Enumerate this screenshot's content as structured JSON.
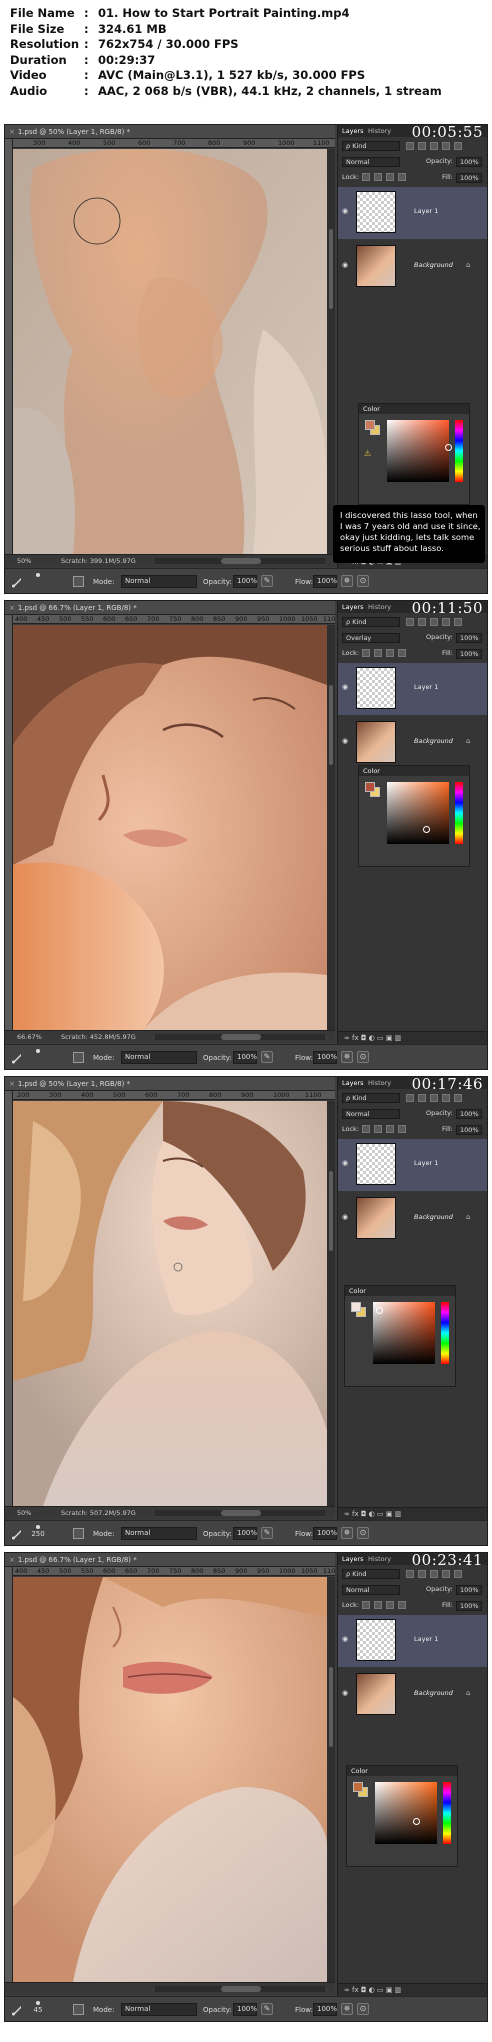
{
  "info": [
    {
      "key": "File Name",
      "value": "01. How to Start Portrait Painting.mp4"
    },
    {
      "key": "File Size",
      "value": "324.61 MB"
    },
    {
      "key": "Resolution",
      "value": "762x754 / 30.000 FPS"
    },
    {
      "key": "Duration",
      "value": "00:29:37"
    },
    {
      "key": "Video",
      "value": "AVC (Main@L3.1), 1 527 kb/s, 30.000 FPS"
    },
    {
      "key": "Audio",
      "value": "AAC, 2 068 b/s (VBR), 44.1 kHz, 2 channels, 1 stream"
    }
  ],
  "info_separator": ":",
  "layers_panel": {
    "tab_layers": "Layers",
    "tab_history": "History",
    "kind_label": "ρ Kind",
    "opacity_label": "Opacity:",
    "lock_label": "Lock:",
    "fill_label": "Fill:",
    "layer1_name": "Layer 1",
    "background_name": "Background",
    "footer_icons": "∞  fx  ◘  ◐  ▭  ▣  ▥"
  },
  "color_panel_title": "Color",
  "options_bar": {
    "mode_label": "Mode:",
    "opacity_label": "Opacity:",
    "flow_label": "Flow:"
  },
  "frames": [
    {
      "timestamp": "00:05:55",
      "doc_title": "1.psd @ 50% (Layer 1, RGB/8) *",
      "ruler_ticks": [
        "300",
        "400",
        "500",
        "600",
        "700",
        "800",
        "900",
        "1000",
        "1100"
      ],
      "zoom": "50%",
      "scratch": "Scratch: 399.1M/5.97G",
      "brush_size": "",
      "mode": "Normal",
      "brush_opacity": "100%",
      "flow": "100%",
      "blend_mode": "Normal",
      "layer_opacity": "100%",
      "fill": "100%",
      "caption": "I discovered this lasso tool, when I was 7 years old and use it since, okay just kidding, lets talk some serious stuff about lasso.",
      "fg_color": "#c97a5e",
      "bg_color": "#e8c865",
      "hue_color": "#ff5a2a"
    },
    {
      "timestamp": "00:11:50",
      "doc_title": "1.psd @ 66.7% (Layer 1, RGB/8) *",
      "ruler_ticks": [
        "400",
        "450",
        "500",
        "550",
        "600",
        "650",
        "700",
        "750",
        "800",
        "850",
        "900",
        "950",
        "1000",
        "1050",
        "1100"
      ],
      "zoom": "66.67%",
      "scratch": "Scratch: 452.8M/5.97G",
      "brush_size": "",
      "mode": "Normal",
      "brush_opacity": "100%",
      "flow": "100%",
      "blend_mode": "Overlay",
      "layer_opacity": "100%",
      "fill": "100%",
      "caption": "",
      "fg_color": "#b4503a",
      "bg_color": "#f0d070",
      "hue_color": "#ff6a22"
    },
    {
      "timestamp": "00:17:46",
      "doc_title": "1.psd @ 50% (Layer 1, RGB/8) *",
      "ruler_ticks": [
        "200",
        "300",
        "400",
        "500",
        "600",
        "700",
        "800",
        "900",
        "1000",
        "1100"
      ],
      "zoom": "50%",
      "scratch": "Scratch: 507.2M/5.97G",
      "brush_size": "250",
      "mode": "Normal",
      "brush_opacity": "100%",
      "flow": "100%",
      "blend_mode": "Normal",
      "layer_opacity": "100%",
      "fill": "100%",
      "caption": "",
      "fg_color": "#f2e4dc",
      "bg_color": "#e8c865",
      "hue_color": "#ff5218"
    },
    {
      "timestamp": "00:23:41",
      "doc_title": "1.psd @ 66.7% (Layer 1, RGB/8) *",
      "ruler_ticks": [
        "400",
        "450",
        "500",
        "550",
        "600",
        "650",
        "700",
        "750",
        "800",
        "850",
        "900",
        "950",
        "1000",
        "1050",
        "1100"
      ],
      "zoom": "",
      "scratch": "",
      "brush_size": "45",
      "mode": "Normal",
      "brush_opacity": "100%",
      "flow": "100%",
      "blend_mode": "Normal",
      "layer_opacity": "100%",
      "fill": "100%",
      "caption": "",
      "fg_color": "#c46c3a",
      "bg_color": "#e8c865",
      "hue_color": "#ff6a18"
    }
  ]
}
